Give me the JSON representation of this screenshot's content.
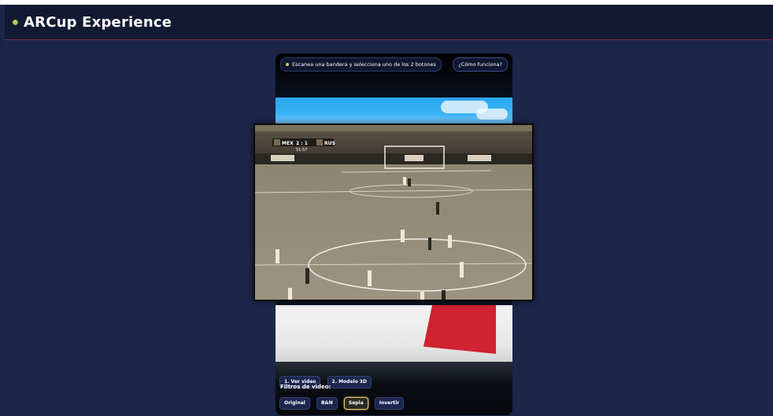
{
  "header": {
    "title": "ARCup Experience"
  },
  "overlay": {
    "instruction": "Escanea una bandera y selecciona uno de los 2 botones",
    "help_label": "¿Cómo funciona?"
  },
  "scoreboard": {
    "team_home": "MEX",
    "score": "2 : 1",
    "team_away": "RUS",
    "clock": "51:57"
  },
  "actions": [
    {
      "label": "1. Ver video"
    },
    {
      "label": "2. Modelo 3D"
    }
  ],
  "filters": {
    "label": "Filtros de video:",
    "options": [
      "Original",
      "B&N",
      "Sepia",
      "Invertir"
    ],
    "selected": "Sepia"
  },
  "colors": {
    "header_bg": "#121a33",
    "page_bg": "#1c2648",
    "accent_border": "#7a2c3a",
    "active_filter": "#e7c86a"
  }
}
